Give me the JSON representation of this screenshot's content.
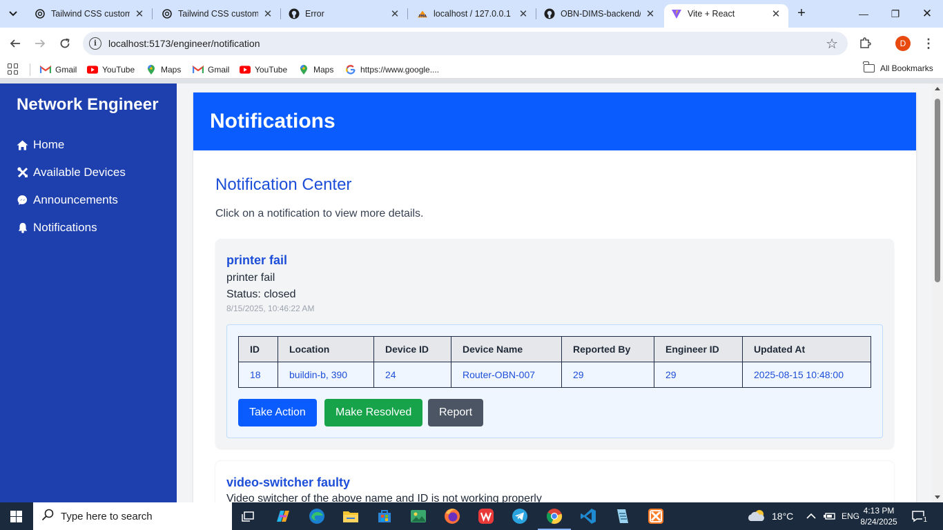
{
  "browser": {
    "tabs": [
      {
        "title": "Tailwind CSS customiz",
        "icon": "openai-icon",
        "active": false
      },
      {
        "title": "Tailwind CSS customiz",
        "icon": "openai-icon",
        "active": false
      },
      {
        "title": "Error",
        "icon": "github-icon",
        "active": false
      },
      {
        "title": "localhost / 127.0.0.1 |",
        "icon": "phpmyadmin-icon",
        "active": false
      },
      {
        "title": "OBN-DIMS-backend/",
        "icon": "github-icon",
        "active": false
      },
      {
        "title": "Vite + React",
        "icon": "vite-icon",
        "active": true
      }
    ],
    "address": "localhost:5173/engineer/notification",
    "profile_initial": "D",
    "bookmarks": [
      {
        "label": "Gmail",
        "icon": "gmail-icon"
      },
      {
        "label": "YouTube",
        "icon": "youtube-icon"
      },
      {
        "label": "Maps",
        "icon": "maps-icon"
      },
      {
        "label": "Gmail",
        "icon": "gmail-icon"
      },
      {
        "label": "YouTube",
        "icon": "youtube-icon"
      },
      {
        "label": "Maps",
        "icon": "maps-icon"
      },
      {
        "label": "https://www.google....",
        "icon": "google-icon"
      }
    ],
    "all_bookmarks": "All Bookmarks"
  },
  "sidebar": {
    "title": "Network Engineer",
    "items": [
      {
        "label": "Home",
        "icon": "home-icon"
      },
      {
        "label": "Available Devices",
        "icon": "tools-icon"
      },
      {
        "label": "Announcements",
        "icon": "messenger-icon"
      },
      {
        "label": "Notifications",
        "icon": "bell-icon"
      }
    ]
  },
  "page": {
    "header_title": "Notifications",
    "center_title": "Notification Center",
    "center_subtitle": "Click on a notification to view more details."
  },
  "notifications": [
    {
      "title": "printer fail",
      "description": "printer fail",
      "status": "Status: closed",
      "timestamp": "8/15/2025, 10:46:22 AM",
      "table": {
        "headers": [
          "ID",
          "Location",
          "Device ID",
          "Device Name",
          "Reported By",
          "Engineer ID",
          "Updated At"
        ],
        "row": [
          "18",
          "buildin-b, 390",
          "24",
          "Router-OBN-007",
          "29",
          "29",
          "2025-08-15 10:48:00"
        ]
      },
      "actions": {
        "take_action": "Take Action",
        "make_resolved": "Make Resolved",
        "report": "Report"
      }
    },
    {
      "title": "video-switcher faulty",
      "description": "Video switcher of the above name and ID is not working properly"
    }
  ],
  "taskbar": {
    "search_placeholder": "Type here to search",
    "weather": "18°C",
    "language": "ENG",
    "time": "4:13 PM",
    "date": "8/24/2025",
    "notification_count": "1"
  },
  "colors": {
    "sidebar": "#1e40af",
    "header": "#0b5cff",
    "accent_text": "#1d4ed8",
    "resolve_button": "#16a34a",
    "report_button": "#4b5563"
  }
}
